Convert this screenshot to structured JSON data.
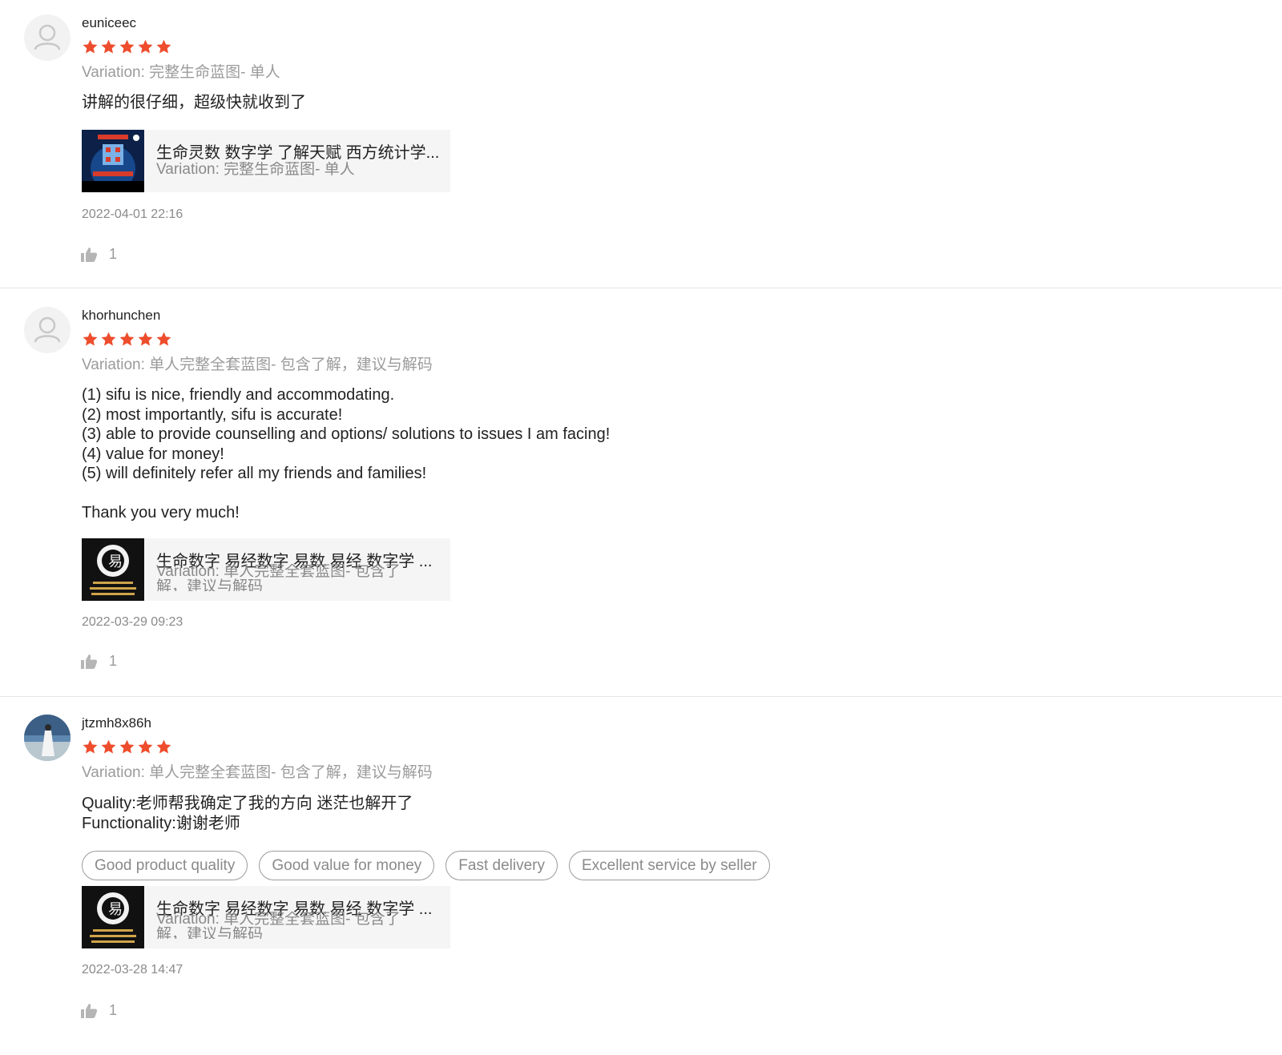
{
  "colors": {
    "star": "#ee4d2d",
    "muted": "#9b9b9b",
    "divider": "#e5e5e5"
  },
  "reviews": [
    {
      "username": "euniceec",
      "rating": 5,
      "variation": "Variation: 完整生命蓝图- 单人",
      "comment": "讲解的很仔细，超级快就收到了",
      "tags": [],
      "product": {
        "name": "生命灵数 数字学 了解天赋 西方统计学...",
        "variation": "Variation: 完整生命蓝图- 单人",
        "thumb": {
          "icon": "numerology-book-cover-thumbnail",
          "caption": "西 方 统 计 学"
        }
      },
      "date": "2022-04-01 22:16",
      "likes": "1"
    },
    {
      "username": "khorhunchen",
      "rating": 5,
      "variation": "Variation: 单人完整全套蓝图- 包含了解，建议与解码",
      "comment": "(1) sifu is nice, friendly and accommodating.\n(2) most importantly, sifu is accurate!\n(3) able to provide counselling and options/ solutions to issues I am facing!\n(4) value for money!\n(5) will definitely refer all my friends and families!\n\nThank you very much!",
      "tags": [],
      "product": {
        "name": "生命数字 易经数字 易数 易经 数字学 ...",
        "variation": "Variation: 单人完整全套蓝图- 包含了解，建议与解码",
        "thumb": {
          "icon": "yijing-numbers-logo-thumbnail",
          "caption": "易"
        }
      },
      "date": "2022-03-29 09:23",
      "likes": "1"
    },
    {
      "username": "jtzmh8x86h",
      "rating": 5,
      "variation": "Variation: 单人完整全套蓝图- 包含了解，建议与解码",
      "comment": "Quality:老师帮我确定了我的方向 迷茫也解开了\nFunctionality:谢谢老师",
      "tags": [
        "Good product quality",
        "Good value for money",
        "Fast delivery",
        "Excellent service by seller"
      ],
      "product": {
        "name": "生命数字 易经数字 易数 易经 数字学 ...",
        "variation": "Variation: 单人完整全套蓝图- 包含了解，建议与解码",
        "thumb": {
          "icon": "yijing-numbers-logo-thumbnail",
          "caption": "易"
        }
      },
      "date": "2022-03-28 14:47",
      "likes": "1"
    }
  ]
}
